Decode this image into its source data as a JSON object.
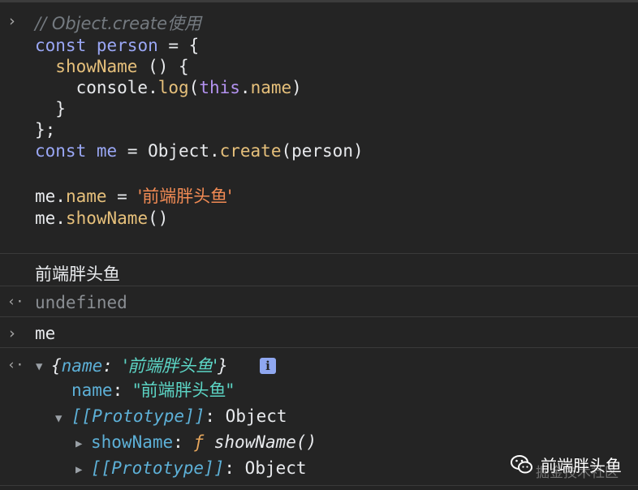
{
  "console": {
    "input_prompt": "›",
    "return_prompt": "‹·",
    "code": {
      "comment": "// Object.create使用",
      "l2_kw": "const",
      "l2_var": "person",
      "l2_rest": " = {",
      "l3_fn": "showName",
      "l3_rest": " () {",
      "l4_obj": "console.",
      "l4_fn": "log",
      "l4_open": "(",
      "l4_this": "this",
      "l4_dot": ".",
      "l4_prop": "name",
      "l4_close": ")",
      "l5": "}",
      "l6": "};",
      "l7_kw": "const",
      "l7_var": "me",
      "l7_mid": " = Object.",
      "l7_fn": "create",
      "l7_end": "(person)",
      "l9_obj": "me.",
      "l9_prop": "name",
      "l9_eq": " = ",
      "l9_str": "'前端胖头鱼'",
      "l10_obj": "me.",
      "l10_fn": "showName",
      "l10_end": "()"
    },
    "log_output": "前端胖头鱼",
    "return_value": "undefined",
    "second_input": "me",
    "object_preview": {
      "open": "{",
      "key": "name",
      "colon": ": ",
      "value": "'前端胖头鱼'",
      "close": "}",
      "info_badge": "i"
    },
    "tree": {
      "name_key": "name",
      "name_value": "\"前端胖头鱼\"",
      "proto_key": "[[Prototype]]",
      "proto_value": "Object",
      "method_key": "showName",
      "method_f": "ƒ",
      "method_sig": "showName()",
      "inner_proto_key": "[[Prototype]]",
      "inner_proto_value": "Object"
    }
  },
  "watermark": {
    "title": "前端胖头鱼",
    "sub": "掘金技术社区",
    "icon": "wechat-icon"
  }
}
